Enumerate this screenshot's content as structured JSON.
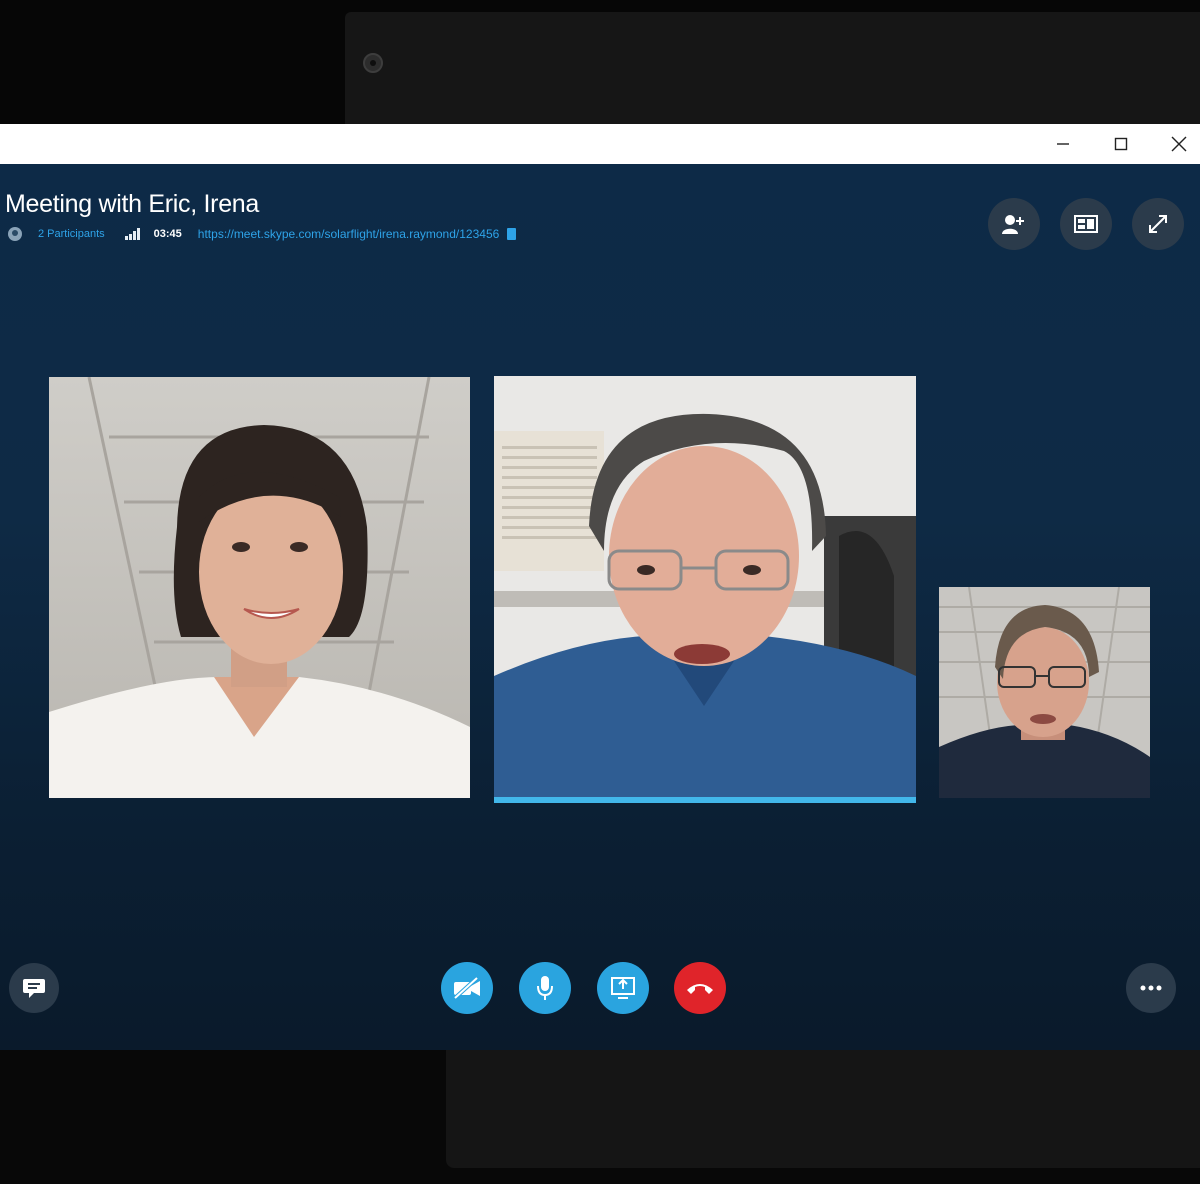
{
  "window": {
    "controls": [
      "minimize",
      "maximize",
      "close"
    ]
  },
  "call": {
    "title": "Meeting with Eric, Irena",
    "participants_label": "2 Participants",
    "duration": "03:45",
    "meeting_link": "https://meet.skype.com/solarflight/irena.raymond/123456"
  },
  "top_actions": [
    {
      "name": "add-participant-button",
      "icon": "add-person-icon"
    },
    {
      "name": "layout-button",
      "icon": "layout-icon"
    },
    {
      "name": "fullscreen-button",
      "icon": "expand-icon"
    }
  ],
  "participants": [
    {
      "tile": "participant-video-woman"
    },
    {
      "tile": "participant-video-active-speaker",
      "active_speaker": true
    },
    {
      "tile": "participant-video-self"
    }
  ],
  "controls": {
    "video": {
      "icon": "video-off-icon",
      "color": "#2aa4df"
    },
    "mic": {
      "icon": "microphone-icon",
      "color": "#2aa4df"
    },
    "share": {
      "icon": "share-screen-icon",
      "color": "#2aa4df"
    },
    "hangup": {
      "icon": "hang-up-icon",
      "color": "#e0242a"
    },
    "chat": {
      "icon": "chat-icon"
    },
    "more": {
      "icon": "more-icon"
    }
  },
  "colors": {
    "background": "#0d2a47",
    "accent": "#2ea3e8",
    "active_speaker_bar": "#42b7ea"
  }
}
